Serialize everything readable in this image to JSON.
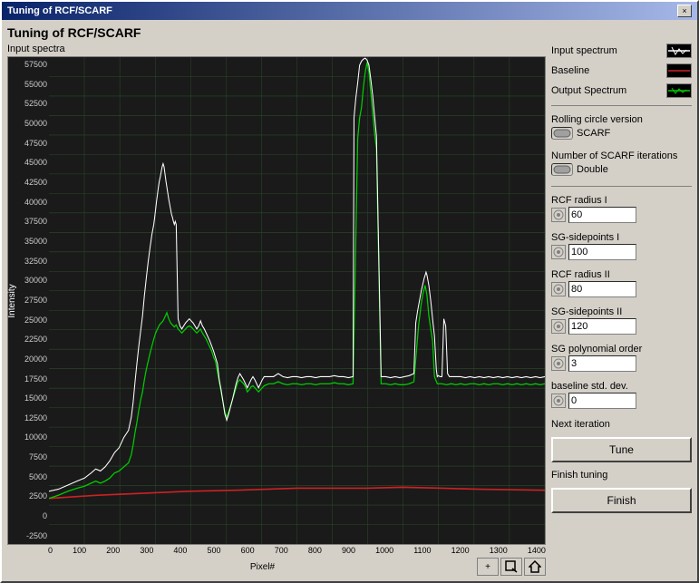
{
  "window": {
    "title": "Tuning of RCF/SCARF",
    "close_button": "×"
  },
  "page_title": "Tuning of RCF/SCARF",
  "chart": {
    "label_top": "Input spectra",
    "y_axis_label": "Intensity",
    "x_axis_label": "Pixel#",
    "y_ticks": [
      "57500",
      "55000",
      "52500",
      "50000",
      "47500",
      "45000",
      "42500",
      "40000",
      "37500",
      "35000",
      "32500",
      "30000",
      "27500",
      "25000",
      "22500",
      "20000",
      "17500",
      "15000",
      "12500",
      "10000",
      "7500",
      "5000",
      "2500",
      "0",
      "-2500"
    ],
    "x_ticks": [
      "0",
      "100",
      "200",
      "300",
      "400",
      "500",
      "600",
      "700",
      "800",
      "900",
      "1000",
      "1100",
      "1200",
      "1300",
      "1400"
    ]
  },
  "legend": {
    "input_spectrum_label": "Input spectrum",
    "baseline_label": "Baseline",
    "output_spectrum_label": "Output Spectrum"
  },
  "controls": {
    "rolling_circle_label": "Rolling circle version",
    "rolling_circle_value": "SCARF",
    "scarf_iterations_label": "Number of SCARF iterations",
    "scarf_iterations_value": "Double",
    "rcf_radius_i_label": "RCF radius I",
    "rcf_radius_i_value": "60",
    "sg_sidepoints_i_label": "SG-sidepoints I",
    "sg_sidepoints_i_value": "100",
    "rcf_radius_ii_label": "RCF radius II",
    "rcf_radius_ii_value": "80",
    "sg_sidepoints_ii_label": "SG-sidepoints II",
    "sg_sidepoints_ii_value": "120",
    "sg_poly_order_label": "SG polynomial order",
    "sg_poly_order_value": "3",
    "baseline_std_label": "baseline std. dev.",
    "baseline_std_value": "0",
    "next_iteration_label": "Next iteration",
    "tune_button": "Tune",
    "finish_tuning_label": "Finish tuning",
    "finish_button": "Finish"
  },
  "toolbar": {
    "zoom_plus": "+",
    "zoom_box": "⊡",
    "zoom_home": "⌂"
  }
}
